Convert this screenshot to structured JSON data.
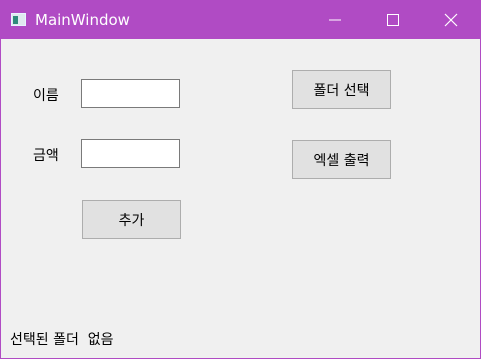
{
  "window": {
    "title": "MainWindow",
    "accent_color": "#b04bc4",
    "icons": [
      "app-icon",
      "minimize-icon",
      "maximize-icon",
      "close-icon"
    ]
  },
  "form": {
    "name_label": "이름",
    "name_value": "",
    "amount_label": "금액",
    "amount_value": "",
    "add_button_label": "추가"
  },
  "actions": {
    "select_folder_label": "폴더 선택",
    "export_excel_label": "엑셀 출력"
  },
  "status": {
    "selected_folder_text": "선택된 폴더  없음"
  }
}
